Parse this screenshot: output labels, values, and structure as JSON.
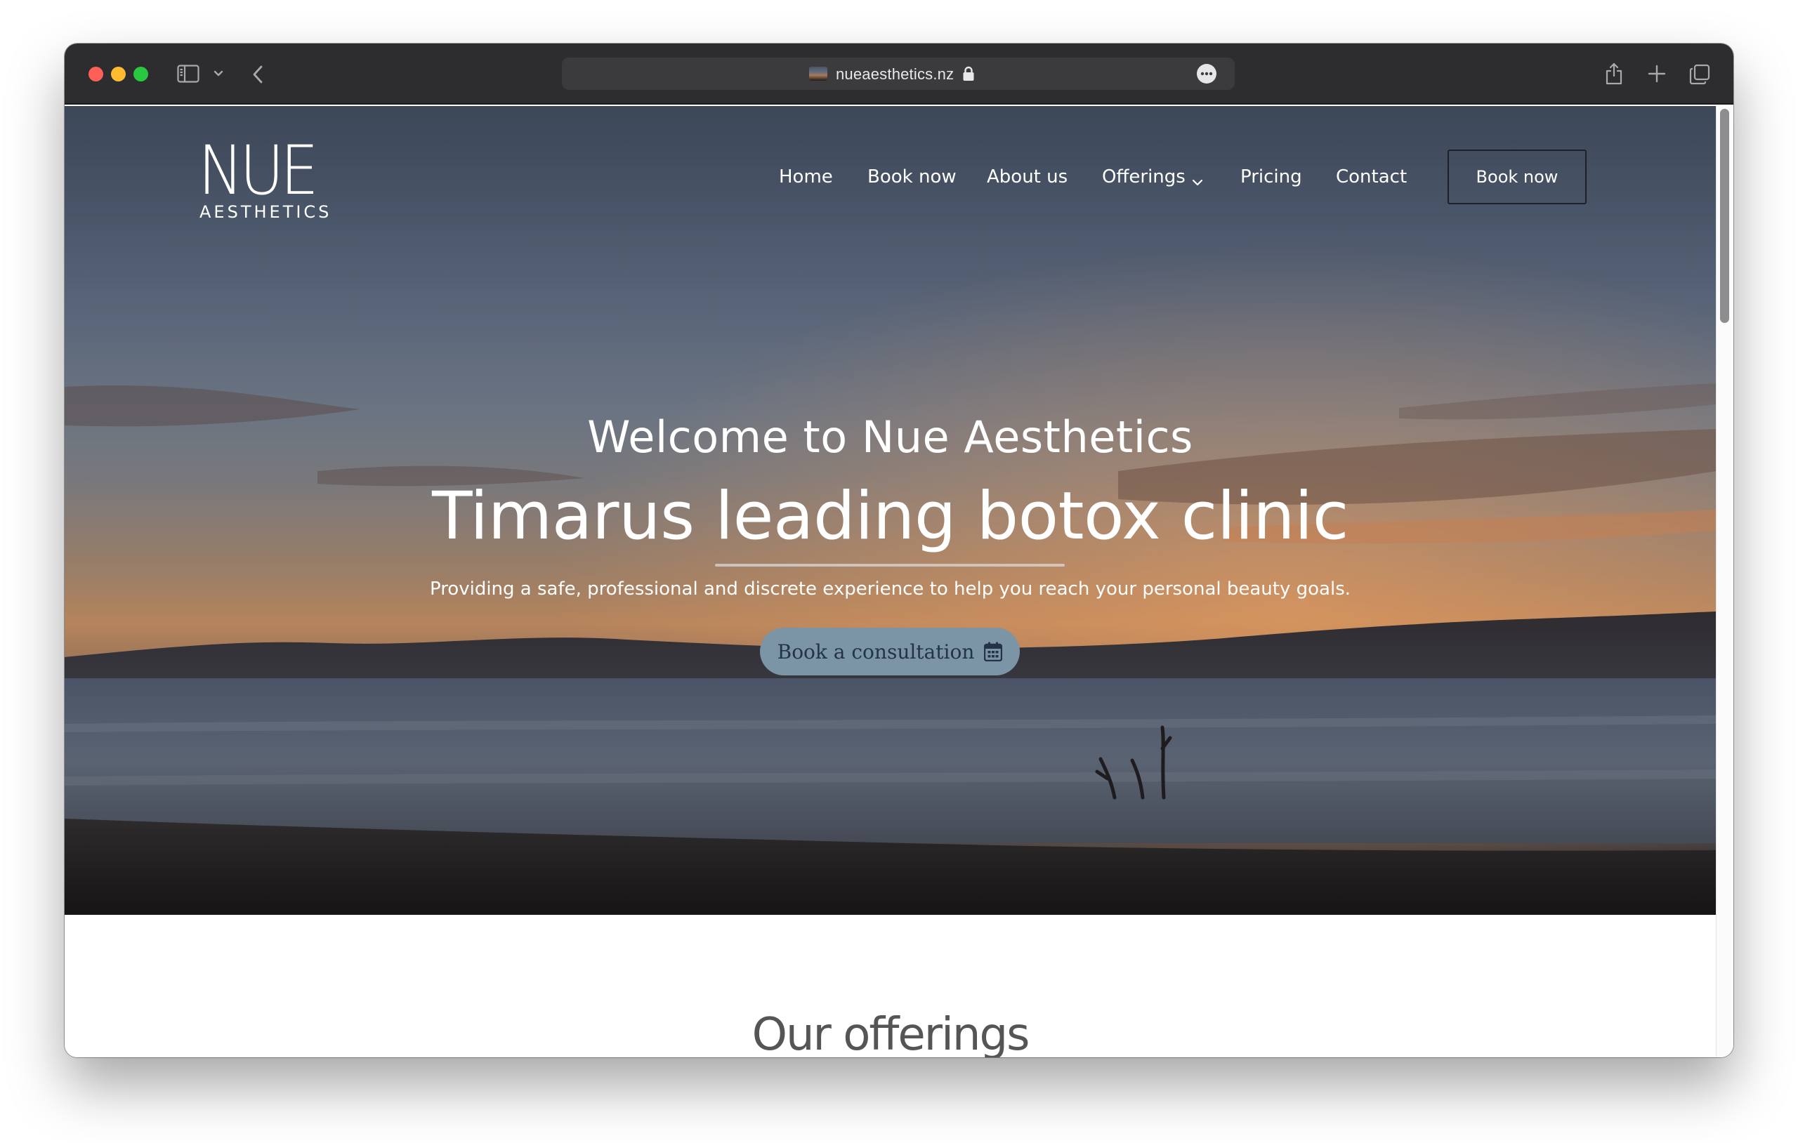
{
  "browser": {
    "url": "nueaesthetics.nz",
    "icons": {
      "sidebar": "sidebar-icon",
      "sidebar_menu": "chevron-down-icon",
      "back": "back-arrow-icon",
      "lock": "lock-icon",
      "more": "ellipsis-icon",
      "share": "share-icon",
      "new_tab": "plus-icon",
      "tabs": "tab-overview-icon"
    }
  },
  "site": {
    "logo": {
      "main": "NUE",
      "sub": "AESTHETICS"
    },
    "nav": {
      "home": "Home",
      "book_now": "Book now",
      "about_us": "About us",
      "offerings": "Offerings",
      "pricing": "Pricing",
      "contact": "Contact",
      "book_button": "Book now"
    },
    "hero": {
      "welcome": "Welcome to Nue Aesthetics",
      "title": "Timarus leading botox clinic",
      "tagline": "Providing a safe, professional and discrete experience to help you reach your personal beauty goals.",
      "cta": "Book a consultation",
      "cta_icon": "calendar-icon"
    },
    "offerings": {
      "title": "Our offerings"
    }
  },
  "colors": {
    "toolbar": "#2d2d2f",
    "address_bar": "#3b3b3d",
    "cta_bg": "#7c95a6",
    "cta_text": "#243444",
    "heading_grey": "#555558"
  }
}
